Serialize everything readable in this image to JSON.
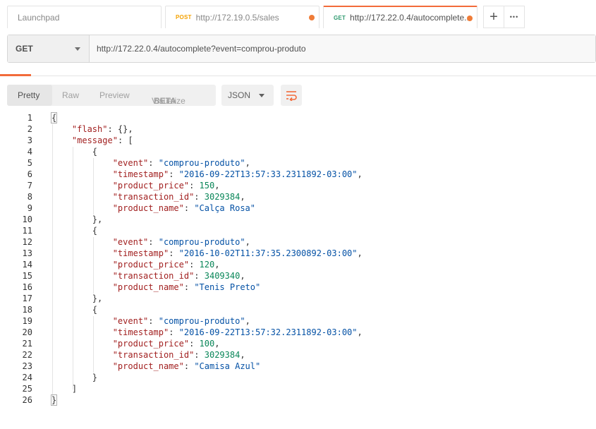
{
  "tabs": [
    {
      "label": "Launchpad",
      "method": "",
      "active": false,
      "unsaved": false
    },
    {
      "label": "http://172.19.0.5/sales",
      "method": "POST",
      "method_color": "#f4a100",
      "active": false,
      "unsaved": true
    },
    {
      "label": "http://172.22.0.4/autocomplete...",
      "method": "GET",
      "method_color": "#2e9a6f",
      "active": true,
      "unsaved": true
    }
  ],
  "tab_actions": {
    "add_icon": "plus-icon",
    "more_icon": "ellipsis-icon",
    "add_glyph": "+",
    "more_glyph": "•••"
  },
  "request": {
    "method": "GET",
    "url": "http://172.22.0.4/autocomplete?event=comprou-produto"
  },
  "response_toolbar": {
    "views": [
      "Pretty",
      "Raw",
      "Preview",
      "Visualize"
    ],
    "beta": "BETA",
    "active_view": "Pretty",
    "format": "JSON",
    "wrap_icon": "wrap-lines-icon"
  },
  "accent_color": "#f26b3a",
  "code_lines": [
    "{",
    "    \"flash\": {},",
    "    \"message\": [",
    "        {",
    "            \"event\": \"comprou-produto\",",
    "            \"timestamp\": \"2016-09-22T13:57:33.2311892-03:00\",",
    "            \"product_price\": 150,",
    "            \"transaction_id\": 3029384,",
    "            \"product_name\": \"Calça Rosa\"",
    "        },",
    "        {",
    "            \"event\": \"comprou-produto\",",
    "            \"timestamp\": \"2016-10-02T11:37:35.2300892-03:00\",",
    "            \"product_price\": 120,",
    "            \"transaction_id\": 3409340,",
    "            \"product_name\": \"Tenis Preto\"",
    "        },",
    "        {",
    "            \"event\": \"comprou-produto\",",
    "            \"timestamp\": \"2016-09-22T13:57:32.2311892-03:00\",",
    "            \"product_price\": 100,",
    "            \"transaction_id\": 3029384,",
    "            \"product_name\": \"Camisa Azul\"",
    "        }",
    "    ]",
    "}"
  ]
}
